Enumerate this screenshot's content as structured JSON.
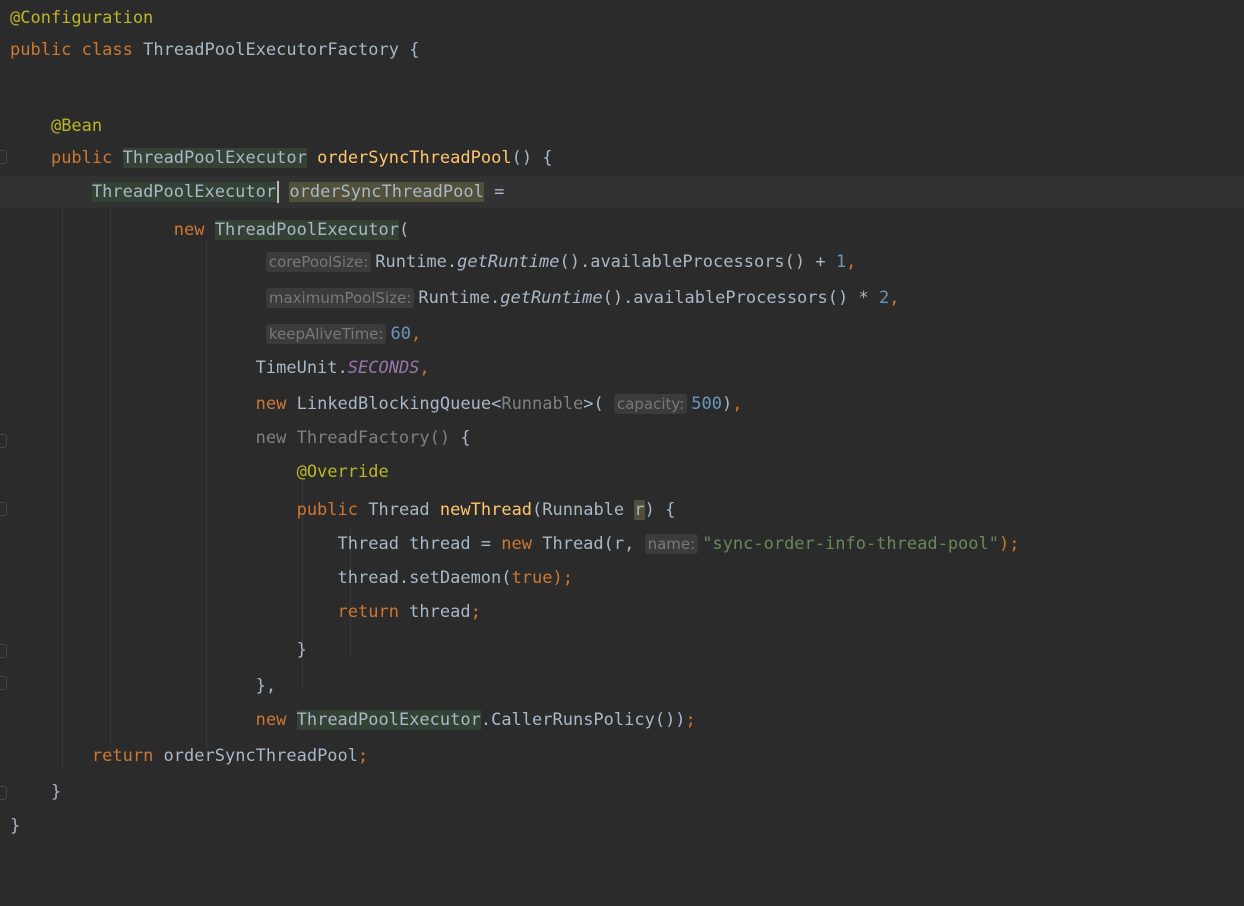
{
  "editor": {
    "theme": {
      "background": "#2b2b2b",
      "current_line": "#323232",
      "keyword": "#cc7832",
      "annotation": "#bbb529",
      "method_decl": "#ffc66d",
      "number": "#6897bb",
      "string": "#6a8759",
      "static_field": "#9876aa",
      "text": "#a9b7c6",
      "hint": "#787878"
    },
    "tokens": {
      "at_configuration": "@Configuration",
      "public": "public",
      "class": "class",
      "class_name": "ThreadPoolExecutorFactory",
      "open_brace": "{",
      "close_brace": "}",
      "at_bean": "@Bean",
      "tpe_type": "ThreadPoolExecutor",
      "method_name": "orderSyncThreadPool",
      "paren_pair": "()",
      "var_name": "orderSyncThreadPool",
      "assign": " =",
      "new": "new",
      "ctor_open": "(",
      "runtime": "Runtime.",
      "get_runtime": "getRuntime",
      "avail_procs": "().availableProcessors()",
      "plus_one": " + ",
      "one": "1",
      "comma": ",",
      "times_two": " * ",
      "two": "2",
      "sixty": "60",
      "timeunit": "TimeUnit.",
      "seconds": "SECONDS",
      "lbq": "LinkedBlockingQueue",
      "lt": "<",
      "runnable_gray": "Runnable",
      "gt_paren": ">(",
      "five_hundred": "500",
      "close_paren": ")",
      "thread_factory_new": "new ThreadFactory()",
      "at_override": "@Override",
      "thread_type": "Thread",
      "new_thread": "newThread",
      "runnable_param_open": "(Runnable ",
      "param_r": "r",
      "param_close": ") ",
      "thread_decl": "Thread thread = ",
      "thread_ctor": " Thread(r, ",
      "thread_name_str": "\"sync-order-info-thread-pool\"",
      "close_paren_semi": ");",
      "set_daemon": "thread.setDaemon(",
      "true_kw": "true",
      "return": "return",
      "thread_ret": " thread",
      "semi": ";",
      "close_brace_comma": "},",
      "crp": ".CallerRunsPolicy())",
      "return_var": " orderSyncThreadPool"
    },
    "hints": {
      "core_pool_size": "corePoolSize:",
      "maximum_pool_size": "maximumPoolSize:",
      "keep_alive_time": "keepAliveTime:",
      "capacity": "capacity:",
      "name": "name:"
    }
  }
}
